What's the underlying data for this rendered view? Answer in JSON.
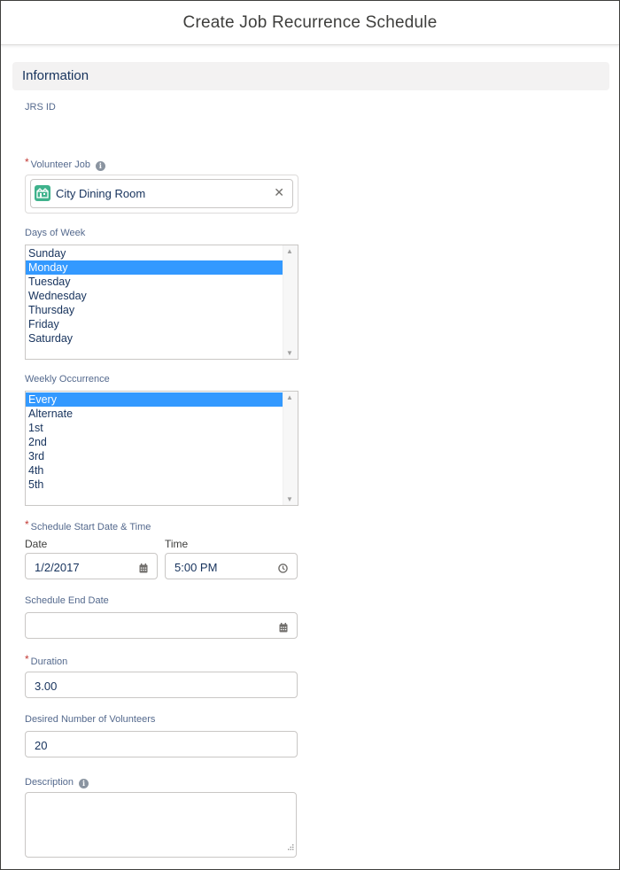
{
  "modal": {
    "title": "Create Job Recurrence Schedule"
  },
  "section": {
    "title": "Information"
  },
  "fields": {
    "jrs_id": {
      "label": "JRS ID",
      "value": ""
    },
    "volunteer_job": {
      "label": "Volunteer Job",
      "required_marker": "*",
      "value": "City Dining Room",
      "icon": "volunteer-job-icon",
      "clear_icon": "close-icon"
    },
    "days_of_week": {
      "label": "Days of Week",
      "options": [
        "Sunday",
        "Monday",
        "Tuesday",
        "Wednesday",
        "Thursday",
        "Friday",
        "Saturday"
      ],
      "selected": "Monday"
    },
    "weekly_occurrence": {
      "label": "Weekly Occurrence",
      "options": [
        "Every",
        "Alternate",
        "1st",
        "2nd",
        "3rd",
        "4th",
        "5th"
      ],
      "selected": "Every"
    },
    "schedule_start": {
      "label": "Schedule Start Date & Time",
      "required_marker": "*",
      "date_label": "Date",
      "date_value": "1/2/2017",
      "time_label": "Time",
      "time_value": "5:00 PM"
    },
    "schedule_end": {
      "label": "Schedule End Date",
      "value": ""
    },
    "duration": {
      "label": "Duration",
      "required_marker": "*",
      "value": "3.00"
    },
    "desired_volunteers": {
      "label": "Desired Number of Volunteers",
      "value": "20"
    },
    "description": {
      "label": "Description",
      "value": ""
    }
  },
  "colors": {
    "selection": "#3399ff",
    "required": "#c23934",
    "label": "#54698d",
    "lookup_icon_bg": "#3fb28c",
    "section_bg": "#f3f2f2"
  }
}
